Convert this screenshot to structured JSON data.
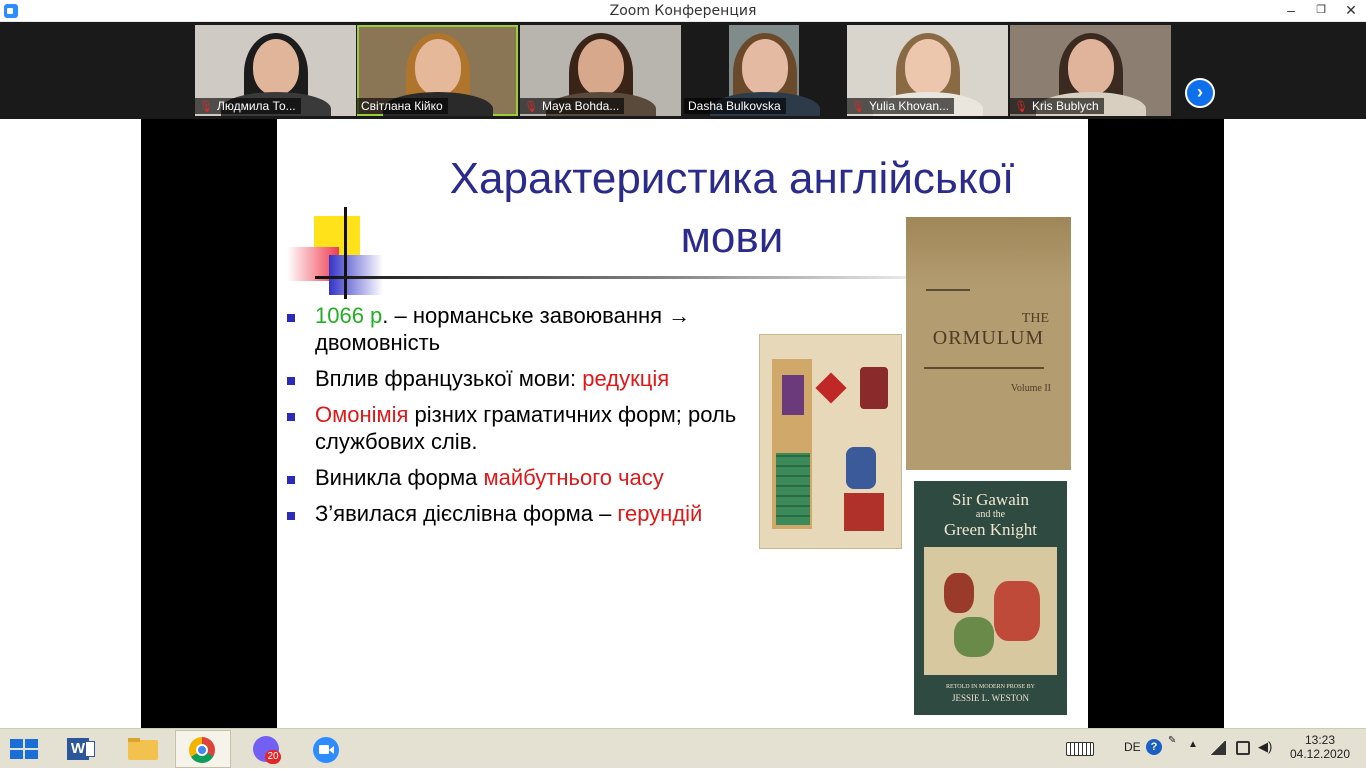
{
  "window": {
    "title": "Zoom Конференция"
  },
  "participants": [
    {
      "name": "Людмила То...",
      "muted": true,
      "active": false
    },
    {
      "name": "Світлана Кійко",
      "muted": false,
      "active": true
    },
    {
      "name": "Maya Bohda...",
      "muted": true,
      "active": false
    },
    {
      "name": "Dasha Bulkovska",
      "muted": false,
      "active": false
    },
    {
      "name": "Yulia Khovan...",
      "muted": true,
      "active": false
    },
    {
      "name": "Kris Bublych",
      "muted": true,
      "active": false
    }
  ],
  "slide": {
    "title": "Характеристика англійської мови",
    "bullets": [
      {
        "parts": [
          {
            "text": "1066 р",
            "color": "green"
          },
          {
            "text": ". – норманське завоювання → двомовність",
            "color": "black"
          }
        ]
      },
      {
        "parts": [
          {
            "text": "Вплив французької мови: ",
            "color": "black"
          },
          {
            "text": "редукція",
            "color": "red"
          }
        ]
      },
      {
        "parts": [
          {
            "text": "Омонімія",
            "color": "red"
          },
          {
            "text": " різних граматичних форм; роль службових слів.",
            "color": "black"
          }
        ]
      },
      {
        "parts": [
          {
            "text": "Виникла форма ",
            "color": "black"
          },
          {
            "text": "майбутнього часу",
            "color": "red"
          }
        ]
      },
      {
        "parts": [
          {
            "text": " З’явилася дієслівна форма – ",
            "color": "black"
          },
          {
            "text": "герундій",
            "color": "red"
          }
        ]
      }
    ],
    "images": {
      "ormulum": {
        "line1": "THE",
        "line2": "ORMULUM",
        "vol": "Volume II"
      },
      "gawain": {
        "title_lines": [
          "Sir Gawain",
          "and the",
          "Green Knight"
        ],
        "footer_lines": [
          "RETOLD IN MODERN PROSE BY",
          "JESSIE L. WESTON"
        ]
      }
    }
  },
  "taskbar": {
    "apps": [
      "word-icon",
      "file-explorer-icon",
      "chrome-icon",
      "viber-icon",
      "zoom-icon"
    ],
    "viber_badge": "20",
    "language": "DE",
    "time": "13:23",
    "date": "04.12.2020"
  },
  "colors": {
    "slide_title": "#2b2b8c",
    "highlight_red": "#e01818",
    "highlight_green": "#22b022",
    "taskbar": "#e4e1d2"
  }
}
